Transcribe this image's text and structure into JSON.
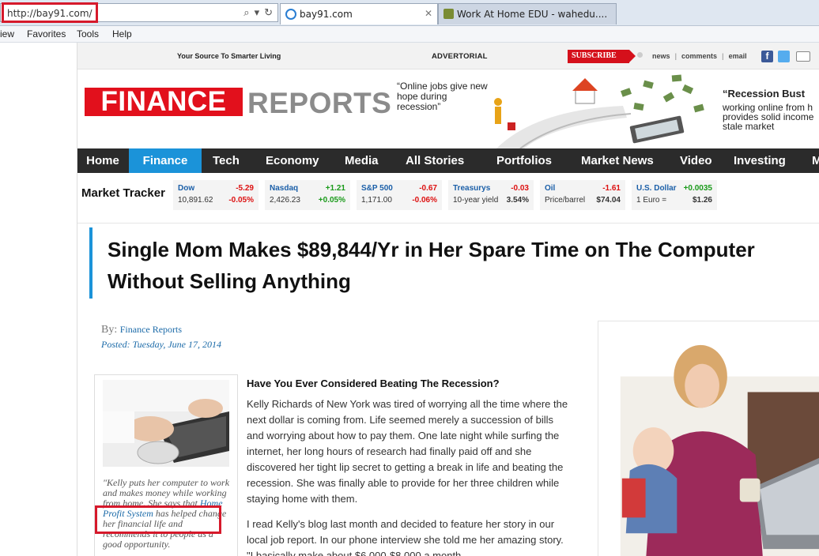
{
  "browser": {
    "address": "http://bay91.com/",
    "tabs": [
      {
        "label": "bay91.com",
        "active": true
      },
      {
        "label": "Work At Home EDU - wahedu....",
        "active": false
      }
    ],
    "menu": [
      "iew",
      "Favorites",
      "Tools",
      "Help"
    ],
    "highlight_color": "#d6192b"
  },
  "site": {
    "tagline": "Your Source To Smarter Living",
    "advertorial": "ADVERTORIAL",
    "subscribe": "SUBSCRIBE",
    "links": [
      "news",
      "comments",
      "email"
    ],
    "logo_red": "FINANCE",
    "logo_gray": "REPORTS",
    "quote1": "“Online jobs give new hope during recession”",
    "quote2_title": "“Recession Bust",
    "quote2_body": "working online from h provides solid income stale market",
    "brand_red": "#e2101c",
    "accent_blue": "#1b93d9"
  },
  "nav": [
    {
      "label": "Home",
      "active": false
    },
    {
      "label": "Finance",
      "active": true
    },
    {
      "label": "Tech",
      "active": false
    },
    {
      "label": "Economy",
      "active": false
    },
    {
      "label": "Media",
      "active": false
    },
    {
      "label": "All Stories",
      "active": false
    },
    {
      "label": "Portfolios",
      "active": false
    },
    {
      "label": "Market News",
      "active": false
    },
    {
      "label": "Video",
      "active": false
    },
    {
      "label": "Investing",
      "active": false
    },
    {
      "label": "M",
      "active": false
    }
  ],
  "tracker": {
    "title": "Market Tracker",
    "tickers": [
      {
        "name": "Dow",
        "change": "-5.29",
        "level": "10,891.62",
        "pct": "-0.05%",
        "dir": "neg"
      },
      {
        "name": "Nasdaq",
        "change": "+1.21",
        "level": "2,426.23",
        "pct": "+0.05%",
        "dir": "pos"
      },
      {
        "name": "S&P 500",
        "change": "-0.67",
        "level": "1,171.00",
        "pct": "-0.06%",
        "dir": "neg"
      },
      {
        "name": "Treasurys",
        "change": "-0.03",
        "level": "10-year yield",
        "pct": "3.54%",
        "dir": "neg"
      },
      {
        "name": "Oil",
        "change": "-1.61",
        "level": "Price/barrel",
        "pct": "$74.04",
        "dir": "neg"
      },
      {
        "name": "U.S. Dollar",
        "change": "+0.0035",
        "level": "1 Euro =",
        "pct": "$1.26",
        "dir": "pos"
      }
    ]
  },
  "article": {
    "headline_line1": "Single Mom Makes $89,844/Yr in Her Spare Time on The Computer",
    "headline_line2": "Without Selling Anything",
    "by_label": "By:",
    "author": "Finance Reports",
    "posted": "Posted: Tuesday, June 17, 2014",
    "subhead": "Have You Ever Considered Beating The Recession?",
    "para1": "Kelly Richards of New York was tired of worrying all the time where the next dollar is coming from. Life seemed merely a succession of bills and worrying about how to pay them. One late night while surfing the internet, her long hours of research had finally paid off and she discovered her tight lip secret to getting a break in life and beating the recession. She was finally able to provide for her three children while staying home with them.",
    "para2": "I read Kelly's blog last month and decided to feature her story in our local job report. In our phone interview she told me her amazing story. \"I basically make about $6,000-$8,000 a month",
    "sidebar_caption_1": "\"Kelly puts her computer to work and makes money while working from home.",
    "sidebar_caption_2": "She says that",
    "sidebar_link": "Home Profit System",
    "sidebar_caption_3": "has helped change her financial life and recommends it to people as a good opportunity."
  }
}
